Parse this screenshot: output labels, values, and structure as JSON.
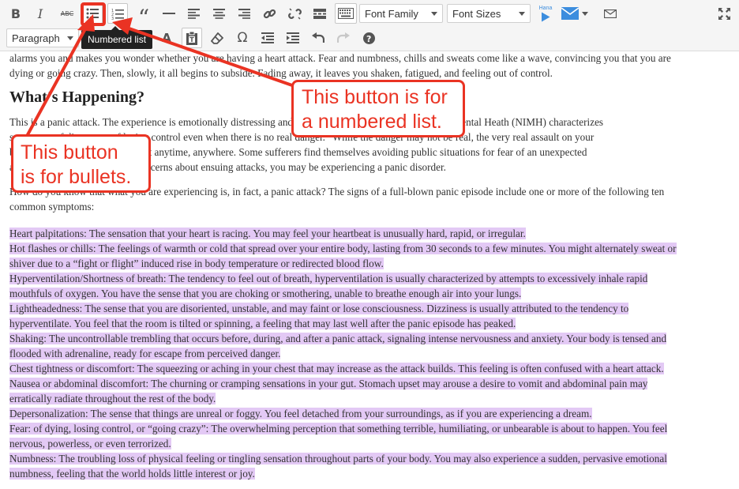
{
  "toolbar": {
    "row1": [
      {
        "name": "bold-button",
        "icon": "bold-icon",
        "glyph": "B"
      },
      {
        "name": "italic-button",
        "icon": "italic-icon",
        "glyph": "I"
      },
      {
        "name": "strikethrough-button",
        "icon": "strikethrough-icon",
        "glyph": "ABC"
      },
      {
        "name": "bulleted-list-button",
        "icon": "bulleted-list-icon"
      },
      {
        "name": "numbered-list-button",
        "icon": "numbered-list-icon"
      },
      {
        "name": "blockquote-button",
        "icon": "quote-icon",
        "glyph": "“"
      },
      {
        "name": "horizontal-line-button",
        "icon": "horizontal-line-icon"
      },
      {
        "name": "align-left-button",
        "icon": "align-left-icon"
      },
      {
        "name": "align-center-button",
        "icon": "align-center-icon"
      },
      {
        "name": "align-right-button",
        "icon": "align-right-icon"
      },
      {
        "name": "insert-link-button",
        "icon": "link-icon"
      },
      {
        "name": "remove-link-button",
        "icon": "unlink-icon"
      },
      {
        "name": "read-more-button",
        "icon": "read-more-icon"
      },
      {
        "name": "toolbar-toggle-button",
        "icon": "keyboard-icon"
      }
    ],
    "font_family": {
      "value": "Font Family"
    },
    "font_sizes": {
      "value": "Font Sizes"
    },
    "hana_label": "Hana",
    "row2": [
      {
        "name": "text-color-button",
        "icon": "text-color-icon",
        "glyph": "A"
      },
      {
        "name": "paste-text-button",
        "icon": "paste-text-icon"
      },
      {
        "name": "clear-formatting-button",
        "icon": "eraser-icon"
      },
      {
        "name": "special-character-button",
        "icon": "omega-icon",
        "glyph": "Ω"
      },
      {
        "name": "outdent-button",
        "icon": "outdent-icon"
      },
      {
        "name": "indent-button",
        "icon": "indent-icon"
      },
      {
        "name": "undo-button",
        "icon": "undo-icon"
      },
      {
        "name": "redo-button",
        "icon": "redo-icon"
      },
      {
        "name": "help-button",
        "icon": "help-icon"
      }
    ],
    "paragraph_format": {
      "value": "Paragraph"
    },
    "tooltip": "Numbered list",
    "colors": {
      "background": "#f5f5f5",
      "icon": "#555555",
      "accent_blue": "#3c8dde"
    }
  },
  "content": {
    "para_intro_1": "alarms you and makes you wonder whether you are having a heart attack. Fear and numbness, chills and sweats come like a wave, convincing you that you are",
    "para_intro_2": "dying or going crazy. Then, slowly, it all begins to subside. Fading away, it leaves you shaken, fatigued, and feeling out of control.",
    "heading": "What’s Happening?",
    "para_happening_1": "This is a panic attack. The experience is emotionally distressing and frightening. The National Institute of Mental Heath (NIMH) characterizes",
    "para_happening_2": "symptoms of disaster or of losing control even when there is no real danger.” While the danger may not be real, the very real assault on your",
    "para_happening_3": "body and mind can be triggered at anytime, anywhere. Some sufferers find themselves avoiding public situations for fear of an unexpected",
    "para_happening_4": "attack. If you have overriding concerns about ensuing attacks, you may be experiencing a panic disorder.",
    "para_signs_1": "How do you know that what you are experiencing is, in fact, a panic attack? The signs of a full-blown panic episode include one or more of the following ten",
    "para_signs_2": "common symptoms:",
    "symptoms": [
      "Heart palpitations: The sensation that your heart is racing. You may feel your heartbeat is unusually hard, rapid, or irregular.",
      "Hot flashes or chills: The feelings of warmth or cold that spread over your entire body, lasting from 30 seconds to a few minutes. You might alternately sweat or",
      "shiver due to a “fight or flight” induced rise in body temperature or redirected blood flow.",
      "Hyperventilation/Shortness of breath: The tendency to feel out of breath, hyperventilation is usually characterized by attempts to excessively inhale rapid",
      "mouthfuls of oxygen. You have the sense that you are choking or smothering, unable to breathe enough air into your lungs.",
      "Lightheadedness: The sense that you are disoriented, unstable, and may faint or lose consciousness. Dizziness is usually attributed to the tendency to",
      "hyperventilate. You feel that the room is tilted or spinning, a feeling that may last well after the panic episode has peaked.",
      "Shaking: The uncontrollable trembling that occurs before, during, and after a panic attack, signaling intense nervousness and anxiety. Your body is tensed and",
      "flooded with adrenaline, ready for escape from perceived danger.",
      "Chest tightness or discomfort: The squeezing or aching in your chest that may increase as the attack builds. This feeling is often confused with a heart attack.",
      "Nausea or abdominal discomfort: The churning or cramping sensations in your gut. Stomach upset may arouse a desire to vomit and abdominal pain may",
      "erratically radiate throughout the rest of the body.",
      "Depersonalization: The sense that things are unreal or foggy. You feel detached from your surroundings, as if you are experiencing a dream.",
      "Fear: of dying, losing control, or “going crazy”: The overwhelming perception that something terrible, humiliating, or unbearable is about to happen. You feel",
      "nervous, powerless, or even terrorized.",
      "Numbness: The troubling loss of physical feeling or tingling sensation throughout parts of your body. You may also experience a sudden, pervasive emotional",
      "numbness, feeling that the world holds little interest or joy."
    ],
    "selection_color": "#e3c9f5"
  },
  "annotations": {
    "numbered_callout_1": "This button is for",
    "numbered_callout_2": "a numbered list.",
    "bullets_callout_1": "This button",
    "bullets_callout_2": "is for bullets.",
    "color": "#ea3323"
  }
}
